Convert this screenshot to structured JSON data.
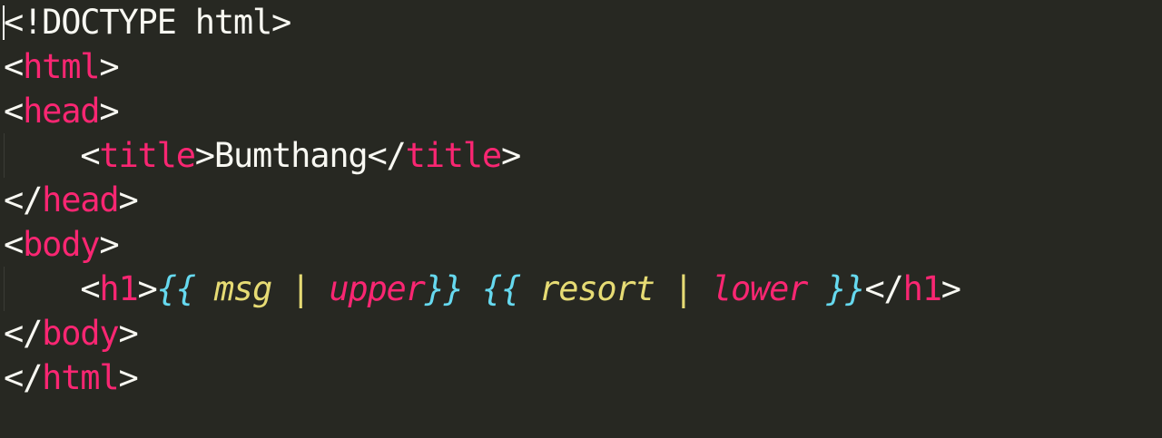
{
  "editor": {
    "theme_colors": {
      "background": "#272822",
      "tag": "#f92672",
      "text": "#f8f8f2",
      "brace": "#66d9ef",
      "variable": "#e6db74"
    },
    "lines": [
      {
        "doctype": "<!DOCTYPE html>"
      },
      {
        "open": "<",
        "tag": "html",
        "close": ">"
      },
      {
        "open": "<",
        "tag": "head",
        "close": ">"
      },
      {
        "indent": "    ",
        "open": "<",
        "tag": "title",
        "close": ">",
        "text": "Bumthang",
        "open2": "</",
        "tag2": "title",
        "close2": ">"
      },
      {
        "open": "</",
        "tag": "head",
        "close": ">"
      },
      {
        "open": "<",
        "tag": "body",
        "close": ">"
      },
      {
        "indent": "    ",
        "open": "<",
        "tag": "h1",
        "close": ">",
        "brace_open_1": "{{",
        "var_1": " msg ",
        "pipe_1": "|",
        "filter_1": " upper",
        "brace_close_1": "}}",
        "space": " ",
        "brace_open_2": "{{",
        "var_2": " resort ",
        "pipe_2": "|",
        "filter_2": " lower ",
        "brace_close_2": "}}",
        "open2": "</",
        "tag2": "h1",
        "close2": ">"
      },
      {
        "open": "</",
        "tag": "body",
        "close": ">"
      },
      {
        "open": "</",
        "tag": "html",
        "close": ">"
      }
    ]
  }
}
